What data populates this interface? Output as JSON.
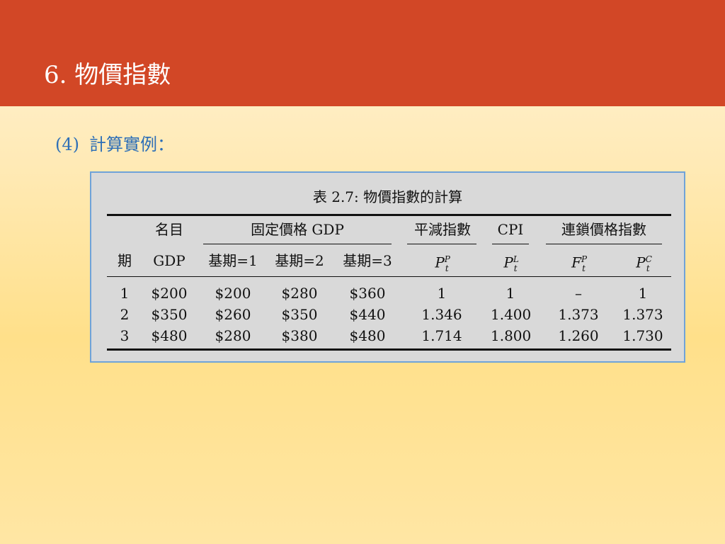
{
  "slide": {
    "title": "6. 物價指數",
    "subheading_number": "(4)",
    "subheading_text": "計算實例："
  },
  "table": {
    "caption": "表 2.7: 物價指數的計算",
    "group_headers": {
      "nominal": "名目",
      "fixed_price_gdp": "固定價格 GDP",
      "deflator": "平減指數",
      "cpi": "CPI",
      "chain": "連鎖價格指數"
    },
    "column_headers": {
      "period": "期",
      "gdp": "GDP",
      "base1": "基期=1",
      "base2": "基期=2",
      "base3": "基期=3"
    },
    "symbols": {
      "deflator": {
        "base": "P",
        "sup": "P",
        "sub": "t"
      },
      "cpi": {
        "base": "P",
        "sup": "L",
        "sub": "t"
      },
      "fisher": {
        "base": "F",
        "sup": "P",
        "sub": "t"
      },
      "chain": {
        "base": "P",
        "sup": "C",
        "sub": "t"
      }
    },
    "rows": [
      [
        "1",
        "$200",
        "$200",
        "$280",
        "$360",
        "1",
        "1",
        "–",
        "1"
      ],
      [
        "2",
        "$350",
        "$260",
        "$350",
        "$440",
        "1.346",
        "1.400",
        "1.373",
        "1.373"
      ],
      [
        "3",
        "$480",
        "$280",
        "$380",
        "$480",
        "1.714",
        "1.800",
        "1.260",
        "1.730"
      ]
    ]
  }
}
